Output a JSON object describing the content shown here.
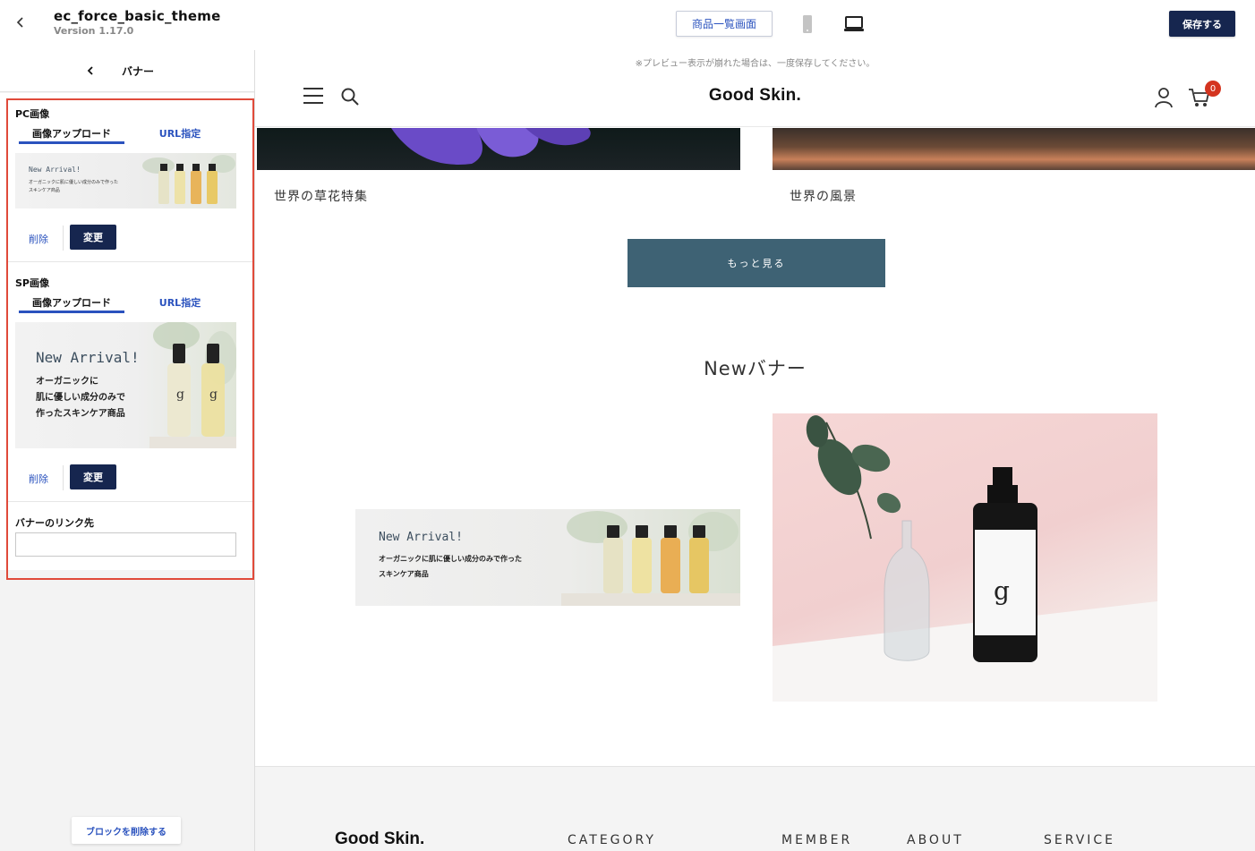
{
  "app": {
    "theme_name": "ec_force_basic_theme",
    "version": "Version 1.17.0",
    "product_list_button": "商品一覧画面",
    "save_button": "保存する"
  },
  "sidebar": {
    "title": "バナー",
    "pc_section": {
      "label": "PC画像",
      "tabs": [
        "画像アップロード",
        "URL指定"
      ],
      "active_tab": "画像アップロード",
      "thumb_title": "New Arrival!",
      "thumb_lines": [
        "オーガニックに肌に優しい成分のみで作った",
        "スキンケア商品"
      ],
      "delete_label": "削除",
      "change_label": "変更"
    },
    "sp_section": {
      "label": "SP画像",
      "tabs": [
        "画像アップロード",
        "URL指定"
      ],
      "active_tab": "画像アップロード",
      "thumb_title": "New Arrival!",
      "thumb_lines": [
        "オーガニックに",
        "肌に優しい成分のみで",
        "作ったスキンケア商品"
      ],
      "delete_label": "削除",
      "change_label": "変更"
    },
    "link": {
      "label": "バナーのリンク先",
      "value": "",
      "placeholder": ""
    },
    "remove_block_button": "ブロックを削除する"
  },
  "preview": {
    "note": "※プレビュー表示が崩れた場合は、一度保存してください。",
    "logo": "Good Skin.",
    "cart_count": "0",
    "features": [
      {
        "caption": "世界の草花特集"
      },
      {
        "caption": "世界の風景"
      }
    ],
    "more_button": "もっと見る",
    "section_title": "Newバナー",
    "banner_left": {
      "title": "New Arrival!",
      "lines": [
        "オーガニックに肌に優しい成分のみで作った",
        "スキンケア商品"
      ]
    },
    "footer": {
      "logo": "Good Skin.",
      "nav": [
        "CATEGORY",
        "MEMBER",
        "ABOUT",
        "SERVICE"
      ]
    }
  },
  "colors": {
    "accent": "#2a52be",
    "primary_dark": "#16264f",
    "more_button": "#3e6274",
    "highlight_frame": "#e04a3a",
    "cart_badge": "#d4341f"
  }
}
